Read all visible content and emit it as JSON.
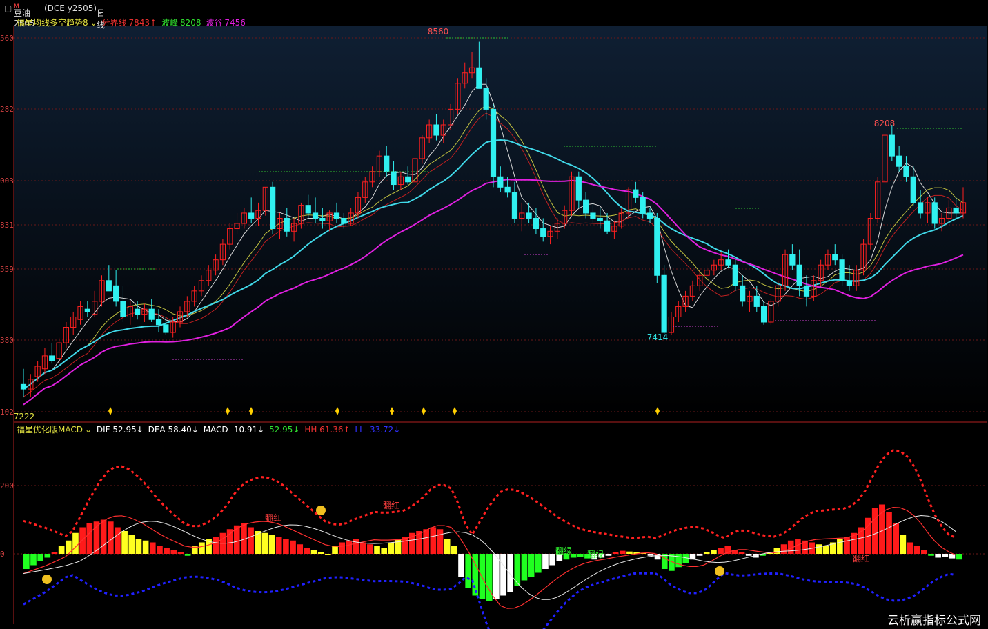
{
  "header": {
    "symbol": "豆油2505",
    "symbol_sup": "M",
    "exchange": "(DCE  y2505)",
    "period": "日线"
  },
  "main_legend": {
    "indicator": "福星均线多空趋势8",
    "divider_label": "分界线",
    "divider_value": "7843↑",
    "peak_label": "波峰",
    "peak_value": "8208",
    "trough_label": "波谷",
    "trough_value": "7456"
  },
  "macd_legend": {
    "indicator": "福星优化版MACD",
    "dif": "DIF 52.95↓",
    "dea": "DEA 58.40↓",
    "macd": "MACD -10.91↓",
    "val": "52.95↓",
    "hh": "HH 61.36↑",
    "ll": "LL -33.72↓"
  },
  "axis_labels": {
    "main": [
      "560",
      "282",
      "003",
      "831",
      "559",
      "380",
      "102"
    ],
    "macd": [
      "200",
      "0"
    ]
  },
  "annotations": {
    "high": "8560",
    "high2": "8208",
    "low": "7414",
    "start": "7222",
    "fan_red": "翻红",
    "fan_green": "翻绿"
  },
  "watermark": "云析赢指标公式网",
  "colors": {
    "up": "#ff2020",
    "down": "#30f0f0",
    "ma_long": "#e020e0",
    "ma_mid": "#40d8e8",
    "macd_pos": "#ff1a1a",
    "macd_yellow": "#ffff20",
    "macd_neg": "#20ff20",
    "macd_white": "#ffffff"
  },
  "chart_data": {
    "type": "candlestick",
    "price_ylim": [
      7100,
      8620
    ],
    "candles": [
      [
        7240,
        7300,
        7190,
        7222
      ],
      [
        7222,
        7280,
        7190,
        7260
      ],
      [
        7270,
        7330,
        7250,
        7310
      ],
      [
        7300,
        7380,
        7280,
        7350
      ],
      [
        7350,
        7400,
        7320,
        7330
      ],
      [
        7340,
        7420,
        7320,
        7400
      ],
      [
        7400,
        7480,
        7380,
        7460
      ],
      [
        7460,
        7520,
        7430,
        7500
      ],
      [
        7490,
        7560,
        7470,
        7540
      ],
      [
        7530,
        7560,
        7500,
        7520
      ],
      [
        7510,
        7600,
        7500,
        7560
      ],
      [
        7560,
        7660,
        7540,
        7640
      ],
      [
        7640,
        7700,
        7620,
        7600
      ],
      [
        7620,
        7680,
        7540,
        7560
      ],
      [
        7560,
        7620,
        7480,
        7500
      ],
      [
        7500,
        7560,
        7470,
        7540
      ],
      [
        7530,
        7560,
        7490,
        7510
      ],
      [
        7510,
        7550,
        7480,
        7530
      ],
      [
        7530,
        7570,
        7480,
        7490
      ],
      [
        7490,
        7530,
        7440,
        7470
      ],
      [
        7470,
        7500,
        7430,
        7440
      ],
      [
        7440,
        7500,
        7420,
        7480
      ],
      [
        7480,
        7540,
        7460,
        7520
      ],
      [
        7520,
        7580,
        7500,
        7560
      ],
      [
        7560,
        7620,
        7540,
        7600
      ],
      [
        7600,
        7660,
        7580,
        7640
      ],
      [
        7640,
        7700,
        7620,
        7680
      ],
      [
        7680,
        7740,
        7660,
        7720
      ],
      [
        7720,
        7800,
        7700,
        7780
      ],
      [
        7780,
        7860,
        7760,
        7840
      ],
      [
        7840,
        7900,
        7820,
        7860
      ],
      [
        7860,
        7920,
        7840,
        7900
      ],
      [
        7900,
        7960,
        7860,
        7880
      ],
      [
        7880,
        7940,
        7850,
        7910
      ],
      [
        7910,
        8000,
        7890,
        8000
      ],
      [
        8000,
        8020,
        7820,
        7840
      ],
      [
        7840,
        7900,
        7800,
        7880
      ],
      [
        7880,
        7920,
        7810,
        7830
      ],
      [
        7830,
        7880,
        7790,
        7860
      ],
      [
        7860,
        7940,
        7840,
        7930
      ],
      [
        7930,
        7970,
        7880,
        7900
      ],
      [
        7900,
        7960,
        7860,
        7880
      ],
      [
        7880,
        7920,
        7840,
        7870
      ],
      [
        7870,
        7910,
        7830,
        7900
      ],
      [
        7900,
        7940,
        7860,
        7880
      ],
      [
        7880,
        7900,
        7840,
        7860
      ],
      [
        7860,
        7920,
        7850,
        7900
      ],
      [
        7900,
        7980,
        7880,
        7960
      ],
      [
        7960,
        8040,
        7940,
        8020
      ],
      [
        8020,
        8080,
        8000,
        8060
      ],
      [
        8060,
        8140,
        8040,
        8120
      ],
      [
        8120,
        8160,
        8040,
        8060
      ],
      [
        8060,
        8100,
        7990,
        8010
      ],
      [
        8010,
        8060,
        7990,
        8040
      ],
      [
        8040,
        8080,
        8010,
        8020
      ],
      [
        8020,
        8120,
        8010,
        8110
      ],
      [
        8110,
        8200,
        8090,
        8190
      ],
      [
        8190,
        8260,
        8170,
        8240
      ],
      [
        8240,
        8280,
        8180,
        8200
      ],
      [
        8200,
        8260,
        8170,
        8240
      ],
      [
        8240,
        8320,
        8220,
        8300
      ],
      [
        8300,
        8420,
        8280,
        8400
      ],
      [
        8400,
        8480,
        8380,
        8440
      ],
      [
        8440,
        8520,
        8420,
        8460
      ],
      [
        8460,
        8560,
        8440,
        8380
      ],
      [
        8380,
        8420,
        8260,
        8300
      ],
      [
        8300,
        8320,
        8000,
        8040
      ],
      [
        8040,
        8080,
        7980,
        8000
      ],
      [
        8000,
        8040,
        7960,
        7980
      ],
      [
        7980,
        8020,
        7860,
        7880
      ],
      [
        7880,
        7940,
        7830,
        7900
      ],
      [
        7900,
        7940,
        7860,
        7880
      ],
      [
        7880,
        7920,
        7820,
        7840
      ],
      [
        7840,
        7880,
        7790,
        7810
      ],
      [
        7810,
        7850,
        7780,
        7830
      ],
      [
        7830,
        7880,
        7800,
        7860
      ],
      [
        7860,
        7930,
        7840,
        7910
      ],
      [
        7910,
        8060,
        7890,
        8040
      ],
      [
        8040,
        8060,
        7920,
        7950
      ],
      [
        7950,
        7980,
        7880,
        7900
      ],
      [
        7900,
        7940,
        7860,
        7880
      ],
      [
        7880,
        7920,
        7840,
        7870
      ],
      [
        7870,
        7900,
        7820,
        7830
      ],
      [
        7830,
        7870,
        7800,
        7850
      ],
      [
        7850,
        7920,
        7840,
        7900
      ],
      [
        7900,
        8000,
        7880,
        7990
      ],
      [
        7990,
        8020,
        7940,
        7960
      ],
      [
        7960,
        7980,
        7880,
        7900
      ],
      [
        7900,
        7920,
        7860,
        7880
      ],
      [
        7880,
        7900,
        7630,
        7660
      ],
      [
        7660,
        7700,
        7414,
        7440
      ],
      [
        7440,
        7520,
        7430,
        7500
      ],
      [
        7500,
        7560,
        7480,
        7540
      ],
      [
        7540,
        7600,
        7520,
        7580
      ],
      [
        7580,
        7640,
        7560,
        7620
      ],
      [
        7620,
        7680,
        7600,
        7660
      ],
      [
        7660,
        7700,
        7640,
        7680
      ],
      [
        7680,
        7720,
        7660,
        7700
      ],
      [
        7700,
        7750,
        7680,
        7720
      ],
      [
        7720,
        7760,
        7690,
        7700
      ],
      [
        7700,
        7720,
        7600,
        7620
      ],
      [
        7620,
        7660,
        7540,
        7560
      ],
      [
        7560,
        7600,
        7520,
        7580
      ],
      [
        7580,
        7620,
        7520,
        7540
      ],
      [
        7540,
        7560,
        7470,
        7480
      ],
      [
        7480,
        7570,
        7470,
        7560
      ],
      [
        7560,
        7640,
        7540,
        7620
      ],
      [
        7620,
        7760,
        7600,
        7740
      ],
      [
        7740,
        7780,
        7680,
        7700
      ],
      [
        7700,
        7760,
        7580,
        7620
      ],
      [
        7620,
        7660,
        7540,
        7580
      ],
      [
        7580,
        7660,
        7560,
        7640
      ],
      [
        7640,
        7720,
        7620,
        7700
      ],
      [
        7700,
        7760,
        7680,
        7740
      ],
      [
        7740,
        7780,
        7700,
        7720
      ],
      [
        7720,
        7740,
        7620,
        7640
      ],
      [
        7640,
        7700,
        7600,
        7620
      ],
      [
        7620,
        7700,
        7600,
        7680
      ],
      [
        7680,
        7800,
        7660,
        7780
      ],
      [
        7780,
        7900,
        7760,
        7880
      ],
      [
        7880,
        8040,
        7860,
        8020
      ],
      [
        8020,
        8220,
        8000,
        8200
      ],
      [
        8200,
        8240,
        8100,
        8120
      ],
      [
        8120,
        8160,
        8060,
        8080
      ],
      [
        8080,
        8120,
        8020,
        8040
      ],
      [
        8040,
        8080,
        7930,
        7940
      ],
      [
        7940,
        7990,
        7880,
        7900
      ],
      [
        7900,
        7960,
        7860,
        7940
      ],
      [
        7940,
        7960,
        7840,
        7860
      ],
      [
        7860,
        7900,
        7830,
        7880
      ],
      [
        7880,
        7950,
        7860,
        7920
      ],
      [
        7920,
        7960,
        7880,
        7900
      ],
      [
        7900,
        8000,
        7880,
        7940
      ]
    ],
    "macd_hist": [
      -40,
      -30,
      -20,
      -10,
      5,
      20,
      35,
      55,
      70,
      80,
      85,
      90,
      85,
      70,
      60,
      50,
      40,
      35,
      30,
      20,
      15,
      10,
      5,
      -5,
      20,
      30,
      40,
      45,
      55,
      65,
      75,
      80,
      70,
      60,
      55,
      50,
      45,
      40,
      35,
      25,
      15,
      10,
      5,
      0,
      20,
      30,
      35,
      40,
      30,
      25,
      20,
      15,
      30,
      40,
      45,
      55,
      60,
      65,
      70,
      65,
      40,
      20,
      -60,
      -90,
      -110,
      -120,
      -125,
      -120,
      -110,
      -100,
      -85,
      -70,
      -60,
      -50,
      -40,
      -30,
      -20,
      -15,
      -10,
      -8,
      -12,
      -15,
      -10,
      -5,
      5,
      8,
      6,
      4,
      2,
      -5,
      -15,
      -40,
      -45,
      -35,
      -25,
      -15,
      -5,
      5,
      10,
      15,
      20,
      10,
      5,
      -5,
      -10,
      -5,
      5,
      15,
      25,
      35,
      40,
      35,
      30,
      25,
      20,
      30,
      40,
      45,
      55,
      70,
      95,
      120,
      130,
      110,
      80,
      50,
      30,
      20,
      10,
      -5,
      -10,
      -8,
      -12,
      -15
    ]
  }
}
